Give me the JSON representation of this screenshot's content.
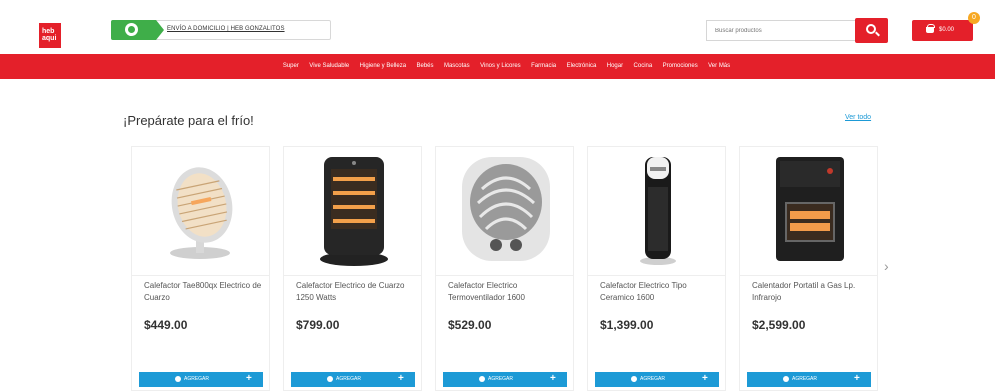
{
  "header": {
    "logo_lines": [
      "heb",
      "aqui"
    ],
    "delivery_text": "ENVÍO A DOMICILIO  |  HEB GONZALITOS",
    "search_placeholder": "Buscar productos",
    "cart_total": "$0.00",
    "cart_count": "0"
  },
  "nav": {
    "items": [
      "Super",
      "Vive Saludable",
      "Higiene y Belleza",
      "Bebés",
      "Mascotas",
      "Vinos y Licores",
      "Farmacia",
      "Electrónica",
      "Hogar",
      "Cocina",
      "Promociones",
      "Ver Más"
    ]
  },
  "section": {
    "title": "¡Prepárate para el frío!",
    "view_all": "Ver todo"
  },
  "products": [
    {
      "name": "Calefactor Tae800qx Electrico de Cuarzo",
      "price": "$449.00",
      "button": "AGREGAR"
    },
    {
      "name": "Calefactor Electrico de Cuarzo 1250 Watts",
      "price": "$799.00",
      "button": "AGREGAR"
    },
    {
      "name": "Calefactor Electrico Termoventilador 1600",
      "price": "$529.00",
      "button": "AGREGAR"
    },
    {
      "name": "Calefactor Electrico Tipo Ceramico 1600",
      "price": "$1,399.00",
      "button": "AGREGAR"
    },
    {
      "name": "Calentador Portatil a Gas Lp. Infrarojo",
      "price": "$2,599.00",
      "button": "AGREGAR"
    }
  ],
  "colors": {
    "brand_red": "#e4202a",
    "delivery_green": "#3fae49",
    "button_blue": "#1d9ad6",
    "badge_orange": "#f7a823"
  }
}
